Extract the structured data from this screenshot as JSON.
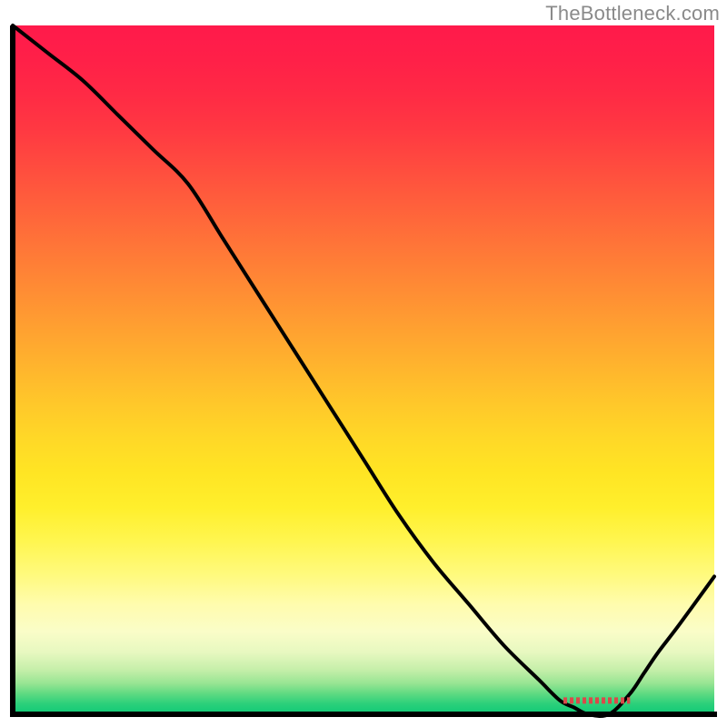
{
  "watermark": "TheBottleneck.com",
  "chart_data": {
    "type": "line",
    "title": "",
    "xlabel": "",
    "ylabel": "",
    "xlim": [
      0,
      100
    ],
    "ylim": [
      0,
      100
    ],
    "x": [
      0,
      5,
      10,
      15,
      20,
      25,
      30,
      35,
      40,
      45,
      50,
      55,
      60,
      65,
      70,
      75,
      78,
      80,
      82,
      85,
      88,
      90,
      92,
      95,
      100
    ],
    "values": [
      100,
      96,
      92,
      87,
      82,
      77,
      69,
      61,
      53,
      45,
      37,
      29,
      22,
      16,
      10,
      5,
      2,
      1,
      0,
      0,
      3,
      6,
      9,
      13,
      20
    ],
    "red_segment": {
      "x": [
        78.5,
        88
      ],
      "y": 2
    },
    "gradient_rows": [
      {
        "y": 0.0,
        "color": "#ff1a4b"
      },
      {
        "y": 0.05,
        "color": "#ff2048"
      },
      {
        "y": 0.1,
        "color": "#ff2a45"
      },
      {
        "y": 0.15,
        "color": "#ff3842"
      },
      {
        "y": 0.2,
        "color": "#ff4a3f"
      },
      {
        "y": 0.25,
        "color": "#ff5c3c"
      },
      {
        "y": 0.3,
        "color": "#ff6e39"
      },
      {
        "y": 0.35,
        "color": "#ff8036"
      },
      {
        "y": 0.4,
        "color": "#ff9233"
      },
      {
        "y": 0.45,
        "color": "#ffa430"
      },
      {
        "y": 0.5,
        "color": "#ffb62d"
      },
      {
        "y": 0.55,
        "color": "#ffc82a"
      },
      {
        "y": 0.6,
        "color": "#ffd827"
      },
      {
        "y": 0.65,
        "color": "#ffe524"
      },
      {
        "y": 0.7,
        "color": "#ffef2c"
      },
      {
        "y": 0.75,
        "color": "#fff651"
      },
      {
        "y": 0.8,
        "color": "#fffa80"
      },
      {
        "y": 0.84,
        "color": "#fffcad"
      },
      {
        "y": 0.88,
        "color": "#fafdc8"
      },
      {
        "y": 0.91,
        "color": "#e7f8c0"
      },
      {
        "y": 0.935,
        "color": "#c6efaa"
      },
      {
        "y": 0.955,
        "color": "#98e593"
      },
      {
        "y": 0.97,
        "color": "#5fda82"
      },
      {
        "y": 0.985,
        "color": "#2bd07a"
      },
      {
        "y": 1.0,
        "color": "#0ec977"
      }
    ]
  }
}
